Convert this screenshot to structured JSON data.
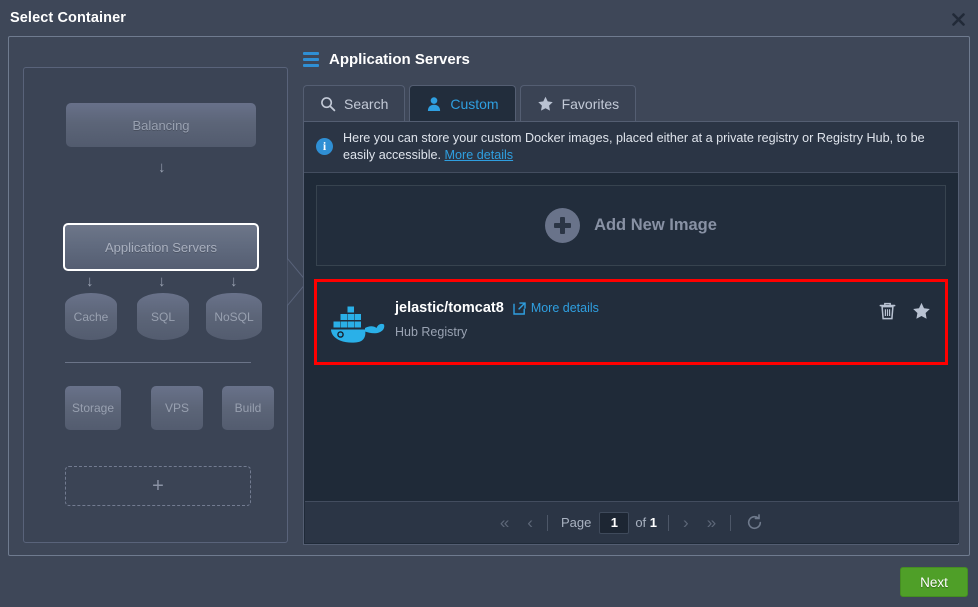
{
  "window": {
    "title": "Select Container",
    "close_icon": "close-icon"
  },
  "topology": {
    "balancing": "Balancing",
    "application_servers": "Application Servers",
    "cache": "Cache",
    "sql": "SQL",
    "nosql": "NoSQL",
    "storage": "Storage",
    "vps": "VPS",
    "build": "Build",
    "add": "+",
    "arrow_glyph": "↓"
  },
  "section": {
    "title": "Application Servers",
    "menu_icon": "hamburger-menu-icon"
  },
  "tabs": [
    {
      "label": "Search",
      "icon": "search-icon",
      "active": false
    },
    {
      "label": "Custom",
      "icon": "user-icon",
      "active": true
    },
    {
      "label": "Favorites",
      "icon": "star-icon",
      "active": false
    }
  ],
  "info": {
    "icon": "info-icon",
    "badge": "i",
    "text": "Here you can store your custom Docker images, placed either at a private registry or Registry Hub, to be easily accessible.",
    "link": "More details"
  },
  "add_image": {
    "label": "Add New Image",
    "icon": "plus-circle-icon"
  },
  "image_row": {
    "logo_icon": "docker-whale-icon",
    "name": "jelastic/tomcat8",
    "more_details": "More details",
    "more_details_icon": "external-link-icon",
    "registry": "Hub Registry",
    "delete_icon": "trash-icon",
    "favorite_icon": "star-icon",
    "highlight_color": "#ff0000"
  },
  "pagination": {
    "first": "«",
    "prev": "‹",
    "page_label": "Page",
    "page_value": "1",
    "of_label": "of",
    "total_pages": "1",
    "next": "›",
    "last": "»",
    "refresh_icon": "refresh-icon"
  },
  "footer": {
    "next_label": "Next"
  },
  "colors": {
    "accent_blue": "#2f9fe0",
    "next_green": "#4f9f28",
    "panel_bg": "#3e4758",
    "content_bg": "#1f2a38",
    "highlight_red": "#ff0000",
    "docker_blue": "#2ab0e8"
  }
}
